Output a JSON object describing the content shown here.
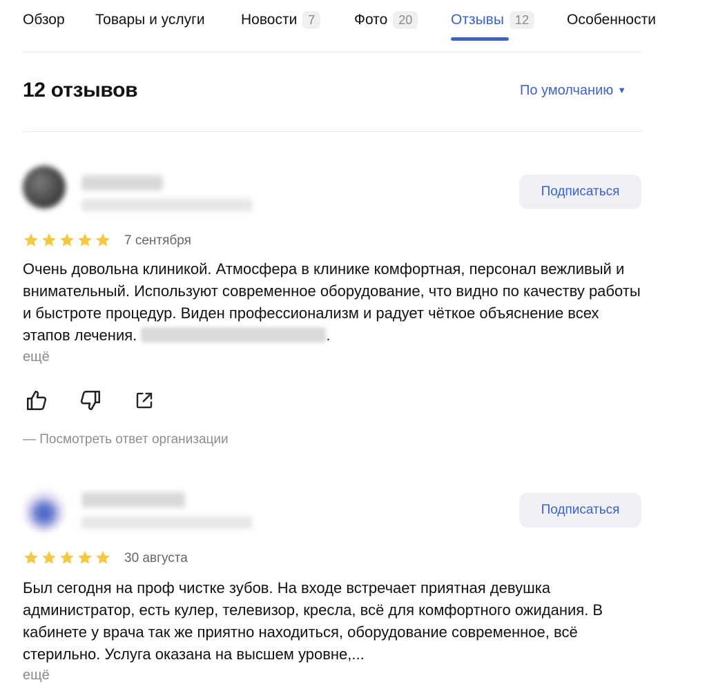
{
  "tabs": [
    {
      "label": "Обзор",
      "count": null
    },
    {
      "label": "Товары и услуги",
      "count": null
    },
    {
      "label": "Новости",
      "count": "7"
    },
    {
      "label": "Фото",
      "count": "20"
    },
    {
      "label": "Отзывы",
      "count": "12"
    },
    {
      "label": "Особенности",
      "count": null
    }
  ],
  "active_tab": "Отзывы",
  "accent_color": "#3b62c9",
  "star_color": "#f5c842",
  "header": {
    "title": "12 отзывов",
    "sort_label": "По умолчанию",
    "sort_caret": "▼"
  },
  "reviews": [
    {
      "subscribe_label": "Подписаться",
      "rating": 5,
      "date": "7 сентября",
      "text": "Очень довольна клиникой. Атмосфера в клинике комфортная, персонал вежливый и внимательный. Используют современное оборудование, что видно по качеству работы и быстроте процедур. Виден профессионализм и радует чёткое объяснение всех этапов лечения.",
      "text_end": ".",
      "more_label": "ещё",
      "response_label": "— Посмотреть ответ организации",
      "actions": [
        "like-icon",
        "dislike-icon",
        "share-icon"
      ]
    },
    {
      "subscribe_label": "Подписаться",
      "rating": 5,
      "date": "30 августа",
      "text": "Был сегодня на проф чистке зубов. На входе встречает приятная девушка администратор, есть кулер, телевизор, кресла, всё для комфортного ожидания. В кабинете у врача так же приятно находиться, оборудование современное, всё стерильно. Услуга оказана на высшем уровне,...",
      "more_label": "ещё"
    }
  ]
}
